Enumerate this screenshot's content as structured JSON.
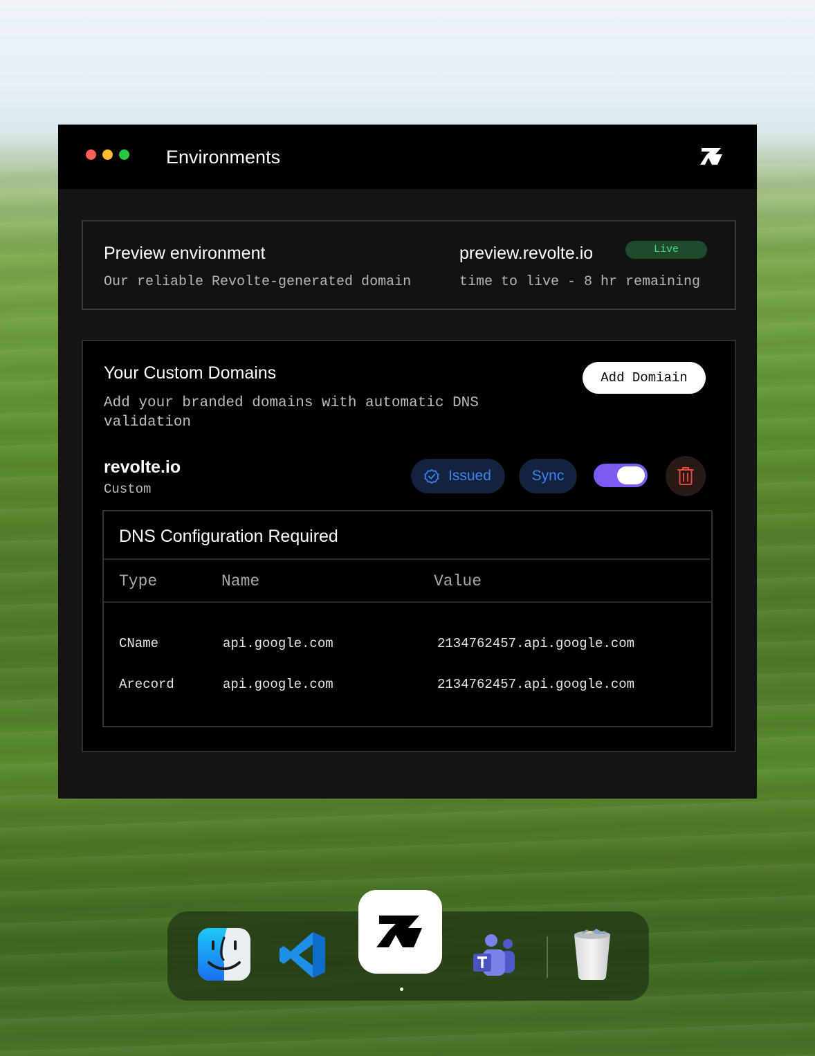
{
  "window": {
    "title": "Environments"
  },
  "preview": {
    "title": "Preview environment",
    "subtitle": "Our reliable Revolte-generated domain",
    "domain": "preview.revolte.io",
    "status": "Live",
    "ttl": "time to live - 8 hr remaining"
  },
  "custom_domains": {
    "title": "Your Custom Domains",
    "subtitle": "Add your branded domains with automatic DNS validation",
    "add_button": "Add Domiain",
    "domain": {
      "name": "revolte.io",
      "kind": "Custom",
      "issued_label": "Issued",
      "sync_label": "Sync",
      "enabled": true
    }
  },
  "dns": {
    "title": "DNS Configuration Required",
    "columns": [
      "Type",
      "Name",
      "Value"
    ],
    "rows": [
      {
        "type": "CName",
        "name": "api.google.com",
        "value": "2134762457.api.google.com"
      },
      {
        "type": "Arecord",
        "name": "api.google.com",
        "value": "2134762457.api.google.com"
      }
    ]
  },
  "dock": {
    "apps": [
      "finder-icon",
      "vscode-icon",
      "revolte-icon",
      "teams-icon",
      "trash-icon"
    ],
    "active": "revolte-icon"
  },
  "colors": {
    "accent_blue": "#3b82f6",
    "toggle_purple": "#7c5cf0",
    "live_green": "#4ade80",
    "danger_red": "#e5483b"
  }
}
